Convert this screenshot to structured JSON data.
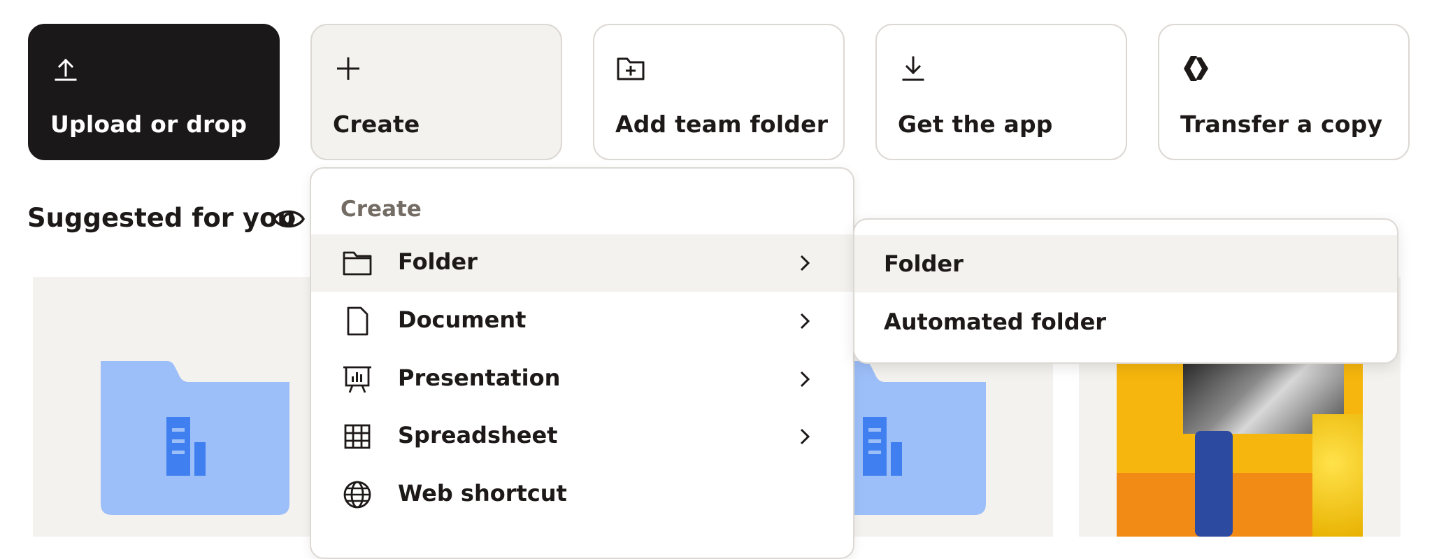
{
  "actions": {
    "upload": {
      "label": "Upload or drop",
      "icon": "upload-icon"
    },
    "create": {
      "label": "Create",
      "icon": "plus-icon"
    },
    "add_team_folder": {
      "label": "Add team folder",
      "icon": "folder-plus-icon"
    },
    "get_app": {
      "label": "Get the app",
      "icon": "download-icon"
    },
    "transfer": {
      "label": "Transfer a copy",
      "icon": "transfer-icon"
    }
  },
  "suggested": {
    "title": "Suggested for you",
    "icon": "eye-icon"
  },
  "create_menu": {
    "title": "Create",
    "items": [
      {
        "label": "Folder",
        "icon": "folder-icon",
        "has_submenu": true,
        "highlighted": true
      },
      {
        "label": "Document",
        "icon": "document-icon",
        "has_submenu": true
      },
      {
        "label": "Presentation",
        "icon": "presentation-icon",
        "has_submenu": true
      },
      {
        "label": "Spreadsheet",
        "icon": "spreadsheet-icon",
        "has_submenu": true
      },
      {
        "label": "Web shortcut",
        "icon": "globe-icon",
        "has_submenu": false
      }
    ]
  },
  "folder_submenu": {
    "items": [
      {
        "label": "Folder",
        "highlighted": true
      },
      {
        "label": "Automated folder"
      }
    ]
  },
  "colors": {
    "primary_bg": "#1a1818",
    "folder_blue": "#9dbff9",
    "folder_building": "#3f7ff0",
    "hover_bg": "#f4f2ee",
    "border": "#dcd8d4"
  }
}
